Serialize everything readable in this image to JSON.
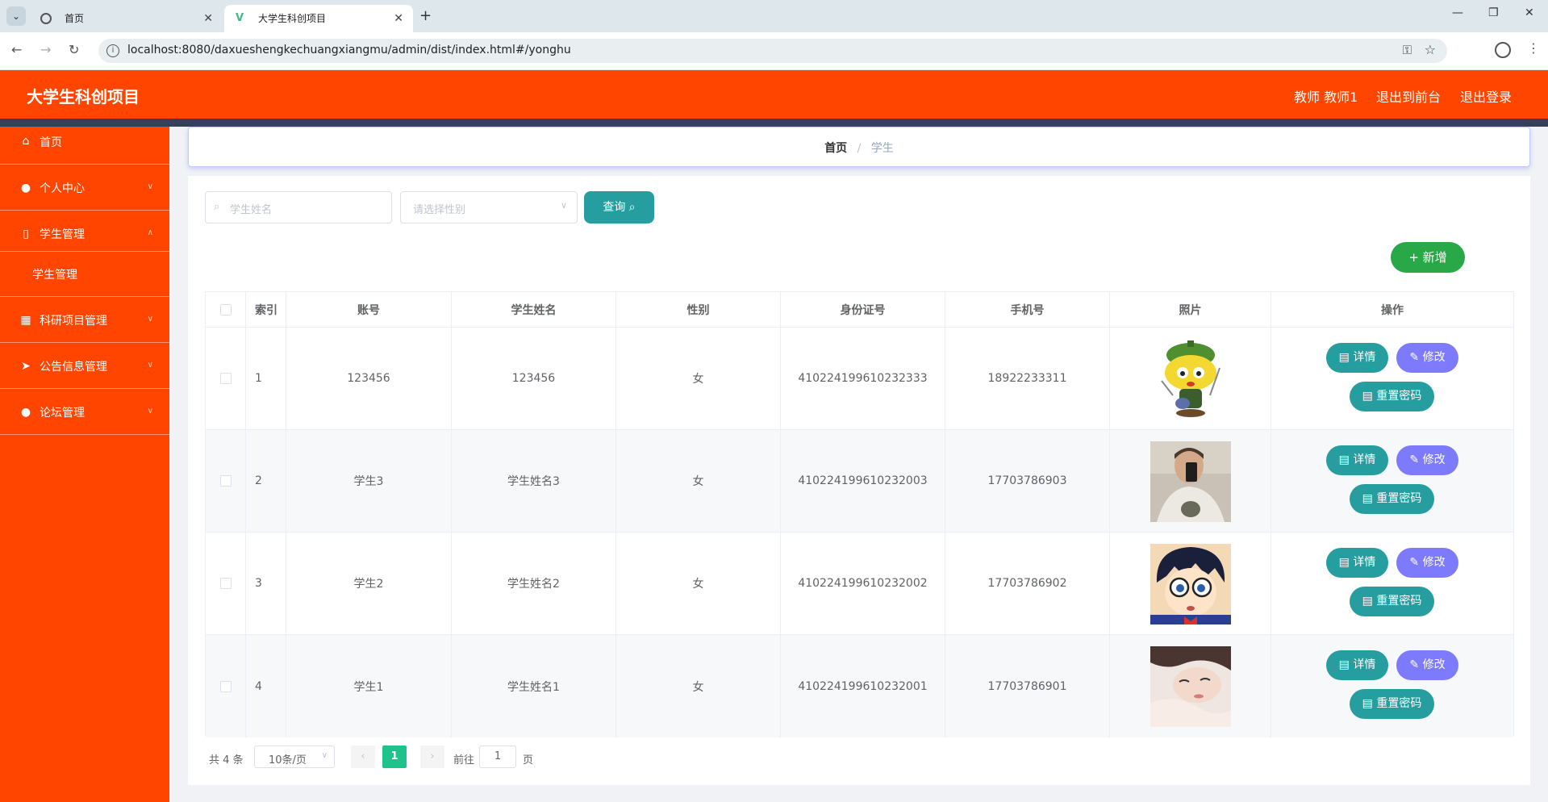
{
  "browser": {
    "tabs": [
      {
        "title": "首页",
        "active": false
      },
      {
        "title": "大学生科创项目",
        "active": true
      }
    ],
    "url": "localhost:8080/daxueshengkechuangxiangmu/admin/dist/index.html#/yonghu"
  },
  "header": {
    "title": "大学生科创项目",
    "user": "教师 教师1",
    "front_link": "退出到前台",
    "logout_link": "退出登录"
  },
  "sidebar": {
    "items": [
      {
        "label": "首页",
        "icon": "home-icon"
      },
      {
        "label": "个人中心",
        "icon": "user-icon"
      },
      {
        "label": "学生管理",
        "icon": "phone-icon",
        "expanded": true
      },
      {
        "label": "科研项目管理",
        "icon": "grid-icon"
      },
      {
        "label": "公告信息管理",
        "icon": "send-icon"
      },
      {
        "label": "论坛管理",
        "icon": "user-icon"
      }
    ],
    "subitem": "学生管理"
  },
  "breadcrumb": {
    "home": "首页",
    "sep": "/",
    "current": "学生"
  },
  "search": {
    "name_placeholder": "学生姓名",
    "gender_placeholder": "请选择性别",
    "query_label": "查询",
    "add_label": "新增"
  },
  "table": {
    "headers": [
      "索引",
      "账号",
      "学生姓名",
      "性别",
      "身份证号",
      "手机号",
      "照片",
      "操作"
    ],
    "rows": [
      {
        "index": "1",
        "account": "123456",
        "name": "123456",
        "gender": "女",
        "id_card": "410224199610232333",
        "phone": "18922233311",
        "photo": "green-cartoon-character"
      },
      {
        "index": "2",
        "account": "学生3",
        "name": "学生姓名3",
        "gender": "女",
        "id_card": "410224199610232003",
        "phone": "17703786903",
        "photo": "man-selfie"
      },
      {
        "index": "3",
        "account": "学生2",
        "name": "学生姓名2",
        "gender": "女",
        "id_card": "410224199610232002",
        "phone": "17703786902",
        "photo": "anime-boy-glasses"
      },
      {
        "index": "4",
        "account": "学生1",
        "name": "学生姓名1",
        "gender": "女",
        "id_card": "410224199610232001",
        "phone": "17703786901",
        "photo": "girl-portrait"
      }
    ],
    "actions": {
      "detail": "详情",
      "edit": "修改",
      "reset": "重置密码"
    }
  },
  "pagination": {
    "total": "共 4 条",
    "page_size": "10条/页",
    "current_page": "1",
    "goto_label": "前往",
    "goto_value": "1",
    "page_unit": "页"
  },
  "colors": {
    "primary": "#ff4500",
    "teal": "#269ea0",
    "purple": "#7d7bfb",
    "green": "#29a847",
    "pager_active": "#1ec28b"
  }
}
